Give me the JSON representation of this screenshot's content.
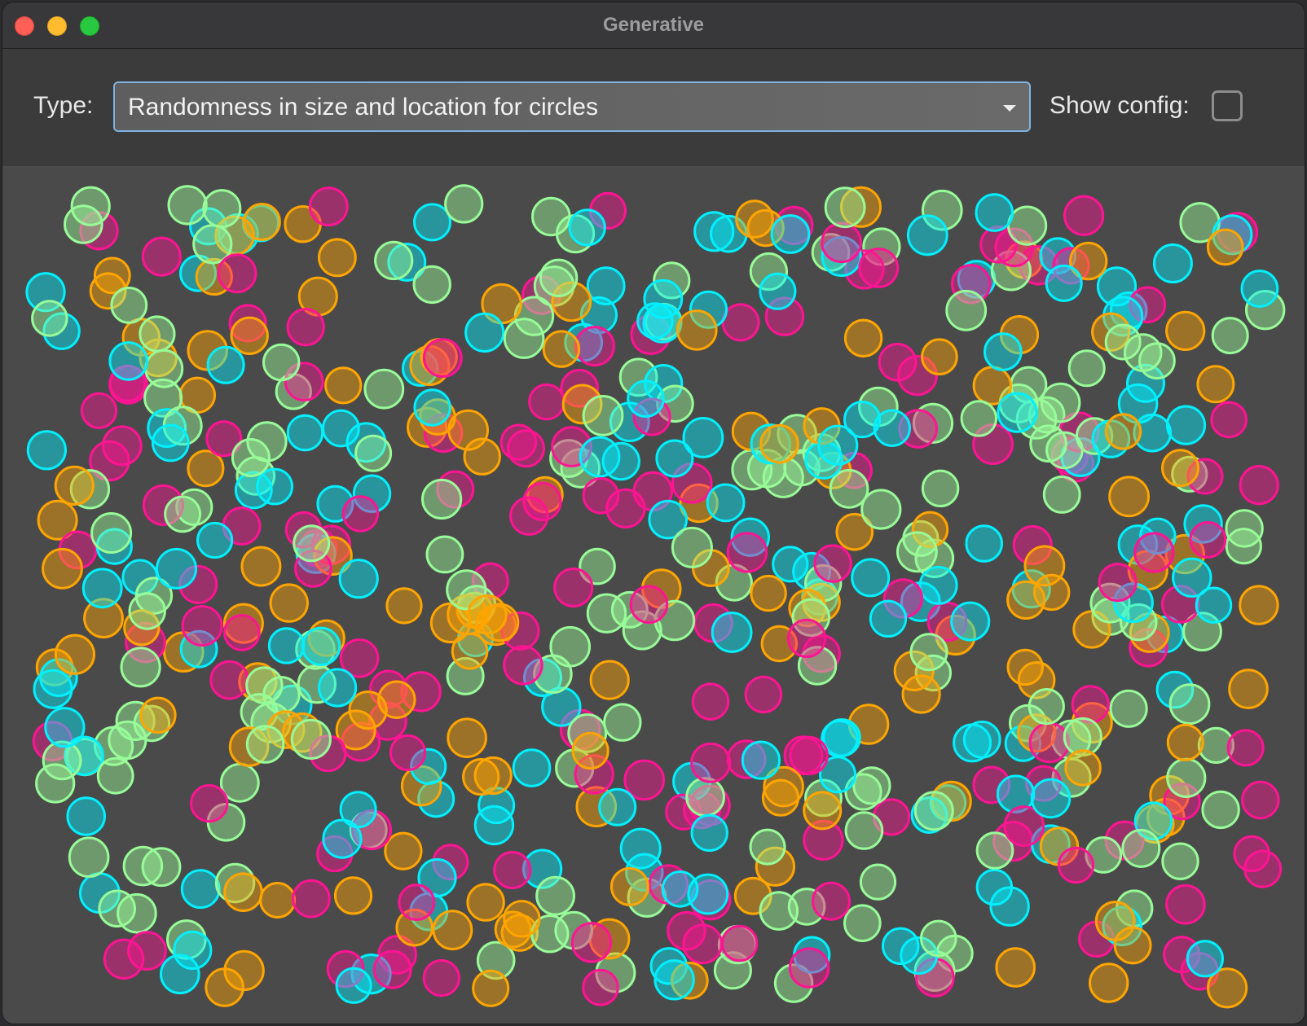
{
  "window": {
    "title": "Generative"
  },
  "toolbar": {
    "type_label": "Type:",
    "type_value": "Randomness in size and location for circles",
    "show_config_label": "Show config:",
    "show_config_checked": false
  },
  "artwork": {
    "palette": {
      "cyan": "#00f0ff",
      "magenta": "#ff1493",
      "orange": "#ffa500",
      "green": "#98fb98"
    },
    "background": "#4a4a4a",
    "circle_fill_opacity": 0.45,
    "circle_count": 620,
    "seed": 20240517
  }
}
